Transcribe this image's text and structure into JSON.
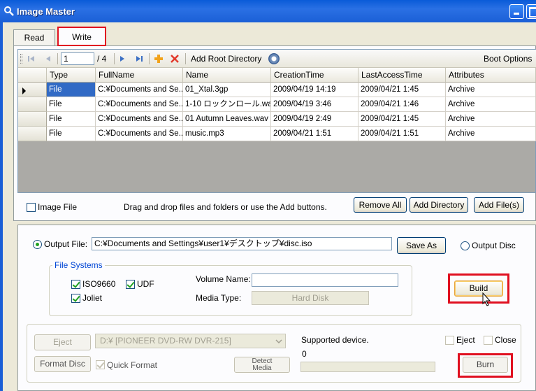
{
  "window": {
    "title": "Image Master"
  },
  "tabs": [
    {
      "label": "Read"
    },
    {
      "label": "Write"
    }
  ],
  "toolbar": {
    "page_value": "1",
    "page_total": "/ 4",
    "add_root_directory": "Add Root Directory",
    "boot_options": "Boot Options"
  },
  "table": {
    "columns": [
      "Type",
      "FullName",
      "Name",
      "CreationTime",
      "LastAccessTime",
      "Attributes"
    ],
    "rows": [
      [
        "File",
        "C:¥Documents and Se...",
        "01_Xtal.3gp",
        "2009/04/19 14:19",
        "2009/04/21 1:45",
        "Archive"
      ],
      [
        "File",
        "C:¥Documents and Se...",
        "1-10 ロックンロール.wav",
        "2009/04/19 3:46",
        "2009/04/21 1:46",
        "Archive"
      ],
      [
        "File",
        "C:¥Documents and Se...",
        "01 Autumn Leaves.wav",
        "2009/04/19 2:49",
        "2009/04/21 1:45",
        "Archive"
      ],
      [
        "File",
        "C:¥Documents and Se...",
        "music.mp3",
        "2009/04/21 1:51",
        "2009/04/21 1:51",
        "Archive"
      ]
    ]
  },
  "files_footer": {
    "image_file_label": "Image File",
    "hint": "Drag and drop files and folders or use the Add buttons.",
    "remove_all": "Remove All",
    "add_directory": "Add Directory",
    "add_files": "Add File(s)"
  },
  "output": {
    "output_file_label": "Output File:",
    "output_file_value": "C:¥Documents and Settings¥user1¥デスクトップ¥disc.iso",
    "save_as": "Save As",
    "output_disc_label": "Output Disc"
  },
  "file_systems": {
    "title": "File Systems",
    "iso9660": "ISO9660",
    "udf": "UDF",
    "joliet": "Joliet",
    "volume_name_label": "Volume Name:",
    "volume_name_value": "",
    "media_type_label": "Media Type:",
    "media_type_value": "Hard Disk"
  },
  "build": {
    "label": "Build"
  },
  "disc": {
    "eject": "Eject",
    "drive": "D:¥ [PIONEER DVD-RW  DVR-215]",
    "supported": "Supported device.",
    "eject_check": "Eject",
    "close_check": "Close",
    "format_disc": "Format Disc",
    "quick_format": "Quick Format",
    "detect_media_1": "Detect",
    "detect_media_2": "Media",
    "progress_value": "0",
    "burn": "Burn"
  },
  "colors": {
    "highlight_red": "#e01020",
    "selection_blue": "#316ac5",
    "titlebar_blue": "#1b5fd6"
  }
}
